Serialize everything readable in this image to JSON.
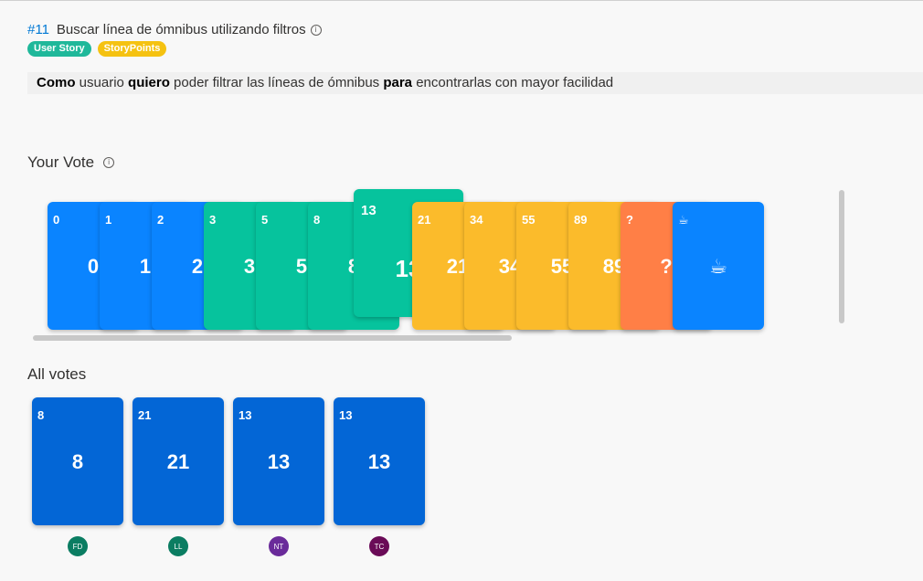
{
  "work_item": {
    "id": "#11",
    "title": "Buscar línea de ómnibus utilizando filtros",
    "tags": [
      {
        "label": "User Story",
        "color": "#1fb89a"
      },
      {
        "label": "StoryPoints",
        "color": "#f5c211"
      }
    ],
    "description": {
      "w1": "Como",
      "t1": " usuario ",
      "w2": "quiero",
      "t2": " poder filtrar las líneas de ómnibus ",
      "w3": "para",
      "t3": " encontrarlas con mayor facilidad"
    }
  },
  "your_vote": {
    "heading": "Your Vote",
    "info_icon": "info-icon",
    "selected": "13",
    "cards": [
      {
        "value": "0",
        "color": "#0a84ff"
      },
      {
        "value": "1",
        "color": "#0a84ff"
      },
      {
        "value": "2",
        "color": "#0a84ff"
      },
      {
        "value": "3",
        "color": "#06c39d"
      },
      {
        "value": "5",
        "color": "#06c39d"
      },
      {
        "value": "8",
        "color": "#06c39d"
      },
      {
        "value": "13",
        "color": "#06c39d"
      },
      {
        "value": "21",
        "color": "#fbbb2b"
      },
      {
        "value": "34",
        "color": "#fbbb2b"
      },
      {
        "value": "55",
        "color": "#fbbb2b"
      },
      {
        "value": "89",
        "color": "#fbbb2b"
      },
      {
        "value": "?",
        "color": "#ff7f46"
      },
      {
        "value": "☕",
        "color": "#0a84ff"
      }
    ]
  },
  "all_votes": {
    "heading": "All votes",
    "card_color": "#0366d6",
    "votes": [
      {
        "value": "8",
        "initials": "FD",
        "avatar_color": "#0b7d62"
      },
      {
        "value": "21",
        "initials": "LL",
        "avatar_color": "#0b7d62"
      },
      {
        "value": "13",
        "initials": "NT",
        "avatar_color": "#6a2b9a"
      },
      {
        "value": "13",
        "initials": "TC",
        "avatar_color": "#6a0b57"
      }
    ]
  }
}
